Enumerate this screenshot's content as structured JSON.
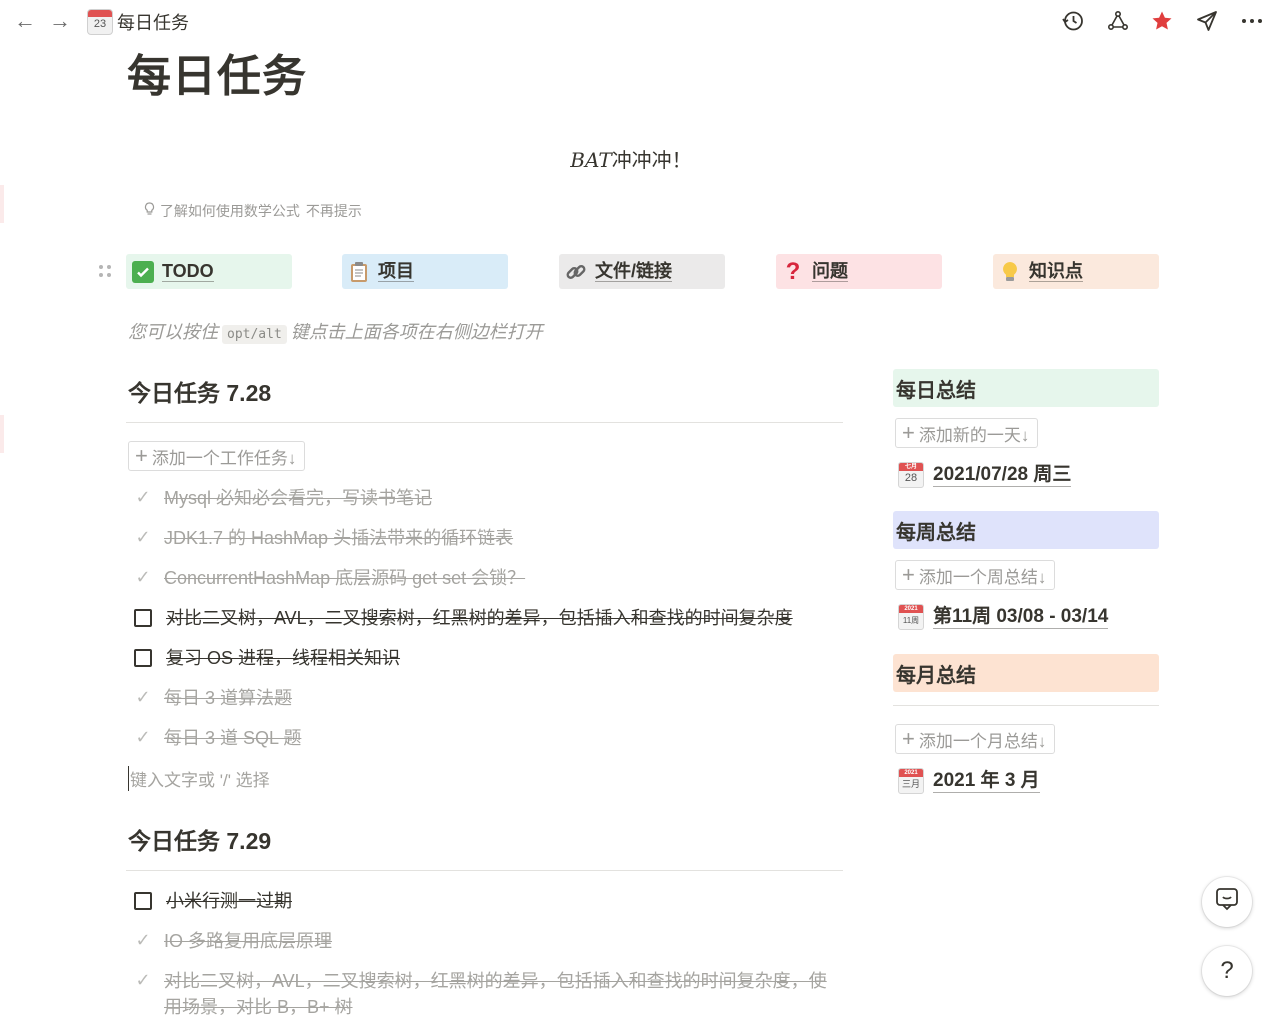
{
  "topbar": {
    "back": "←",
    "forward": "→",
    "icon_day": "23",
    "breadcrumb": "每日任务",
    "icons": [
      "history-icon",
      "share-graph-icon",
      "favorite-star-icon",
      "send-icon",
      "more-icon"
    ],
    "star_color": "#e03e3e"
  },
  "page": {
    "title": "每日任务",
    "math_italic": "BAT",
    "math_rest": "冲冲冲！",
    "hint_learn": "了解如何使用数学公式",
    "hint_dismiss": "不再提示"
  },
  "categories": [
    {
      "label": "TODO",
      "icon": "check-mark-button-icon",
      "bg": "#e6f6ec"
    },
    {
      "label": "项目",
      "icon": "clipboard-icon",
      "bg": "#d9ecf8"
    },
    {
      "label": "文件/链接",
      "icon": "link-icon",
      "bg": "#ebeaea"
    },
    {
      "label": "问题",
      "icon": "question-mark-icon",
      "bg": "#fde2e4"
    },
    {
      "label": "知识点",
      "icon": "lightbulb-icon",
      "bg": "#fbe9dd"
    }
  ],
  "tip": {
    "before": "您可以按住",
    "key": "opt/alt",
    "after": "键点击上面各项在右侧边栏打开"
  },
  "day1": {
    "heading": "今日任务 7.28",
    "add_label": "添加一个工作任务↓",
    "tasks": [
      {
        "text": "Mysql 必知必会看完，写读书笔记",
        "done": true
      },
      {
        "text": "JDK1.7 的 HashMap 头插法带来的循环链表",
        "done": true
      },
      {
        "text": "ConcurrentHashMap 底层源码 get set 会锁？",
        "done": true
      },
      {
        "text": "对比二叉树，AVL，二叉搜索树，红黑树的差异，包括插入和查找的时间复杂度",
        "done": false
      },
      {
        "text": "复习 OS 进程，线程相关知识",
        "done": false
      },
      {
        "text": "每日 3 道算法题",
        "done": true
      },
      {
        "text": "每日 3 道 SQL 题",
        "done": true
      }
    ],
    "placeholder": "键入文字或 '/' 选择"
  },
  "day2": {
    "heading": "今日任务 7.29",
    "tasks": [
      {
        "text": "小米行测一过期",
        "done": false
      },
      {
        "text": "IO 多路复用底层原理",
        "done": true
      },
      {
        "text": "对比二叉树，AVL，二叉搜索树，红黑树的差异，包括插入和查找的时间复杂度，使用场景，对比 B，B+ 树",
        "done": true
      }
    ]
  },
  "sidebar": {
    "daily": {
      "title": "每日总结",
      "bg": "#e6f6ec",
      "add": "添加新的一天↓",
      "cal_top": "七月",
      "cal_num": "28",
      "link": "2021/07/28 周三"
    },
    "weekly": {
      "title": "每周总结",
      "bg": "#dfe3fb",
      "add": "添加一个周总结↓",
      "cal_top": "2021",
      "cal_num": "11周",
      "link": "第11周 03/08 - 03/14"
    },
    "monthly": {
      "title": "每月总结",
      "bg": "#fde3d2",
      "add": "添加一个月总结↓",
      "cal_top": "2021",
      "cal_num": "三月",
      "link": "2021 年 3 月"
    }
  },
  "fabs": {
    "help": "?"
  }
}
